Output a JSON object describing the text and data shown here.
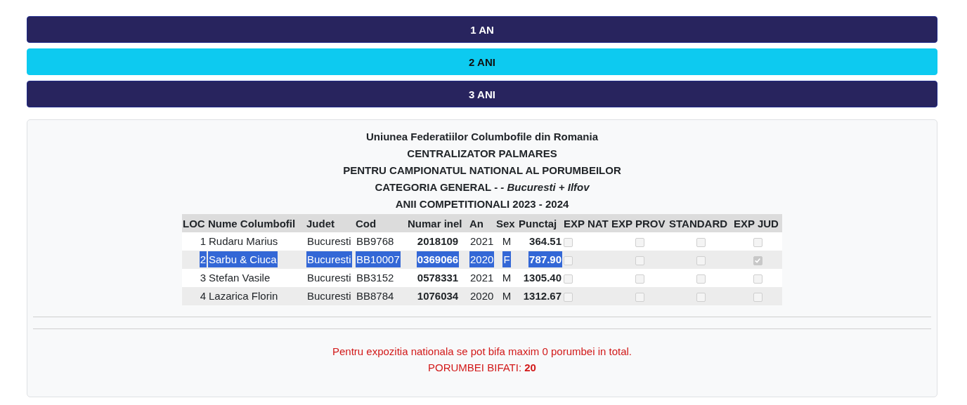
{
  "tabs": [
    {
      "label": "1 AN",
      "selected": false
    },
    {
      "label": "2 ANI",
      "selected": true
    },
    {
      "label": "3 ANI",
      "selected": false
    }
  ],
  "report": {
    "title_lines": [
      "Uniunea Federatiilor Columbofile din Romania",
      "CENTRALIZATOR PALMARES",
      "PENTRU CAMPIONATUL NATIONAL AL PORUMBEILOR",
      "CATEGORIA GENERAL - *- Bucuresti + Ilfov*",
      "ANII COMPETITIONALI 2023 - 2024"
    ],
    "table": {
      "columns": [
        "LOC",
        "Nume Columbofil",
        "Judet",
        "Cod",
        "Numar inel",
        "An",
        "Sex",
        "Punctaj",
        "EXP NAT",
        "EXP PROV",
        "STANDARD",
        "EXP JUD"
      ],
      "rows": [
        {
          "loc": "1",
          "name": "Rudaru Marius",
          "judet": "Bucuresti",
          "cod": "BB9768",
          "inel": "2018109",
          "an": "2021",
          "sex": "M",
          "punctaj": "364.51",
          "selected": false,
          "checks": [
            {
              "checked": false
            },
            {
              "checked": false
            },
            {
              "checked": false
            },
            {
              "checked": false
            }
          ]
        },
        {
          "loc": "2",
          "name": "Sarbu & Ciuca",
          "judet": "Bucuresti",
          "cod": "BB10007",
          "inel": "0369066",
          "an": "2020",
          "sex": "F",
          "punctaj": "787.90",
          "selected": true,
          "checks": [
            {
              "checked": false
            },
            {
              "checked": false
            },
            {
              "checked": false
            },
            {
              "checked": true
            }
          ]
        },
        {
          "loc": "3",
          "name": "Stefan Vasile",
          "judet": "Bucuresti",
          "cod": "BB3152",
          "inel": "0578331",
          "an": "2021",
          "sex": "M",
          "punctaj": "1305.40",
          "selected": false,
          "checks": [
            {
              "checked": false
            },
            {
              "checked": false
            },
            {
              "checked": false
            },
            {
              "checked": false
            }
          ]
        },
        {
          "loc": "4",
          "name": "Lazarica Florin",
          "judet": "Bucuresti",
          "cod": "BB8784",
          "inel": "1076034",
          "an": "2020",
          "sex": "M",
          "punctaj": "1312.67",
          "selected": false,
          "checks": [
            {
              "checked": false
            },
            {
              "checked": false
            },
            {
              "checked": false
            },
            {
              "checked": false
            }
          ]
        }
      ]
    },
    "notice": "Pentru expozitia nationala se pot bifa maxim 0 porumbei in total.",
    "count_label": "PORUMBEI BIFATI:",
    "count_value": "20"
  }
}
